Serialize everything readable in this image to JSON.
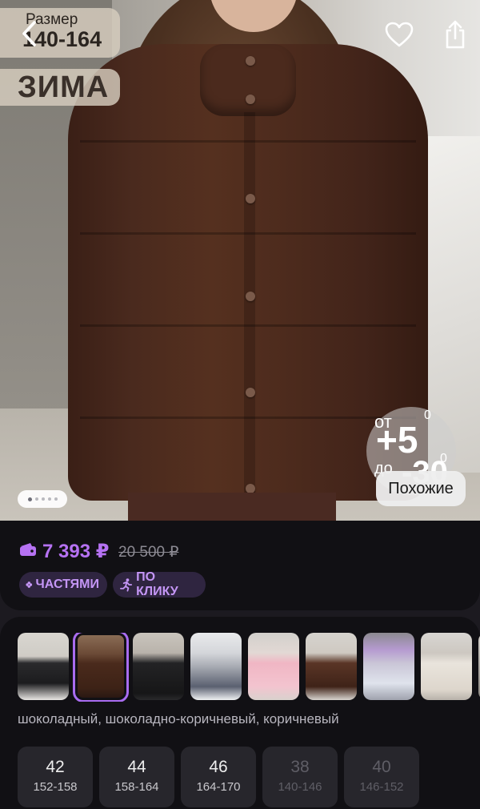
{
  "header": {
    "back_icon": "chevron-left-icon",
    "favorite_icon": "heart-icon",
    "share_icon": "share-icon"
  },
  "photo": {
    "size_label": "Размер",
    "size_range": "140-164",
    "season": "ЗИМА",
    "temp_from_label": "от",
    "temp_from": "+5",
    "temp_to_label": "до",
    "temp_to": "-30",
    "degree": "0",
    "similar_button": "Похожие",
    "gallery_total": 5,
    "gallery_current": 1
  },
  "price": {
    "current": "7 393 ₽",
    "old": "20 500 ₽",
    "accent_color": "#b672f3",
    "chips": [
      {
        "icon": "clover-icon",
        "label": "ЧАСТЯМИ"
      },
      {
        "icon": "runner-icon",
        "label": "ПО КЛИКУ"
      }
    ]
  },
  "variants": {
    "color_names": "шоколадный, шоколадно-коричневый, коричневый",
    "selected_index": 1,
    "sizes": [
      {
        "size": "42",
        "height": "152-158",
        "available": true
      },
      {
        "size": "44",
        "height": "158-164",
        "available": true
      },
      {
        "size": "46",
        "height": "164-170",
        "available": true
      },
      {
        "size": "38",
        "height": "140-146",
        "available": false
      },
      {
        "size": "40",
        "height": "146-152",
        "available": false
      }
    ]
  }
}
